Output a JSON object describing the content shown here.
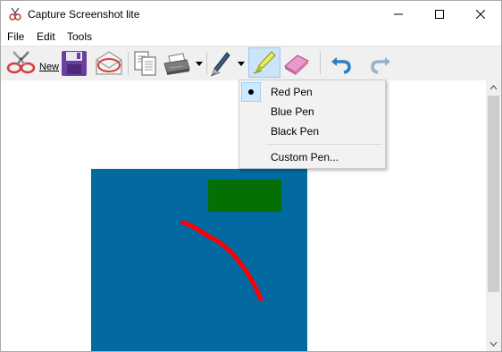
{
  "window": {
    "title": "Capture Screenshot lite"
  },
  "menubar": {
    "items": [
      "File",
      "Edit",
      "Tools"
    ]
  },
  "toolbar": {
    "new_label": "New"
  },
  "pen_menu": {
    "items": [
      {
        "label": "Red Pen",
        "checked": true
      },
      {
        "label": "Blue Pen",
        "checked": false
      },
      {
        "label": "Black Pen",
        "checked": false
      },
      {
        "label": "Custom Pen...",
        "checked": false
      }
    ]
  },
  "canvas": {
    "background_color": "#ffffff",
    "image_bg_color": "#0369a1",
    "rect_color": "#047004",
    "stroke_color": "#ff0000"
  }
}
